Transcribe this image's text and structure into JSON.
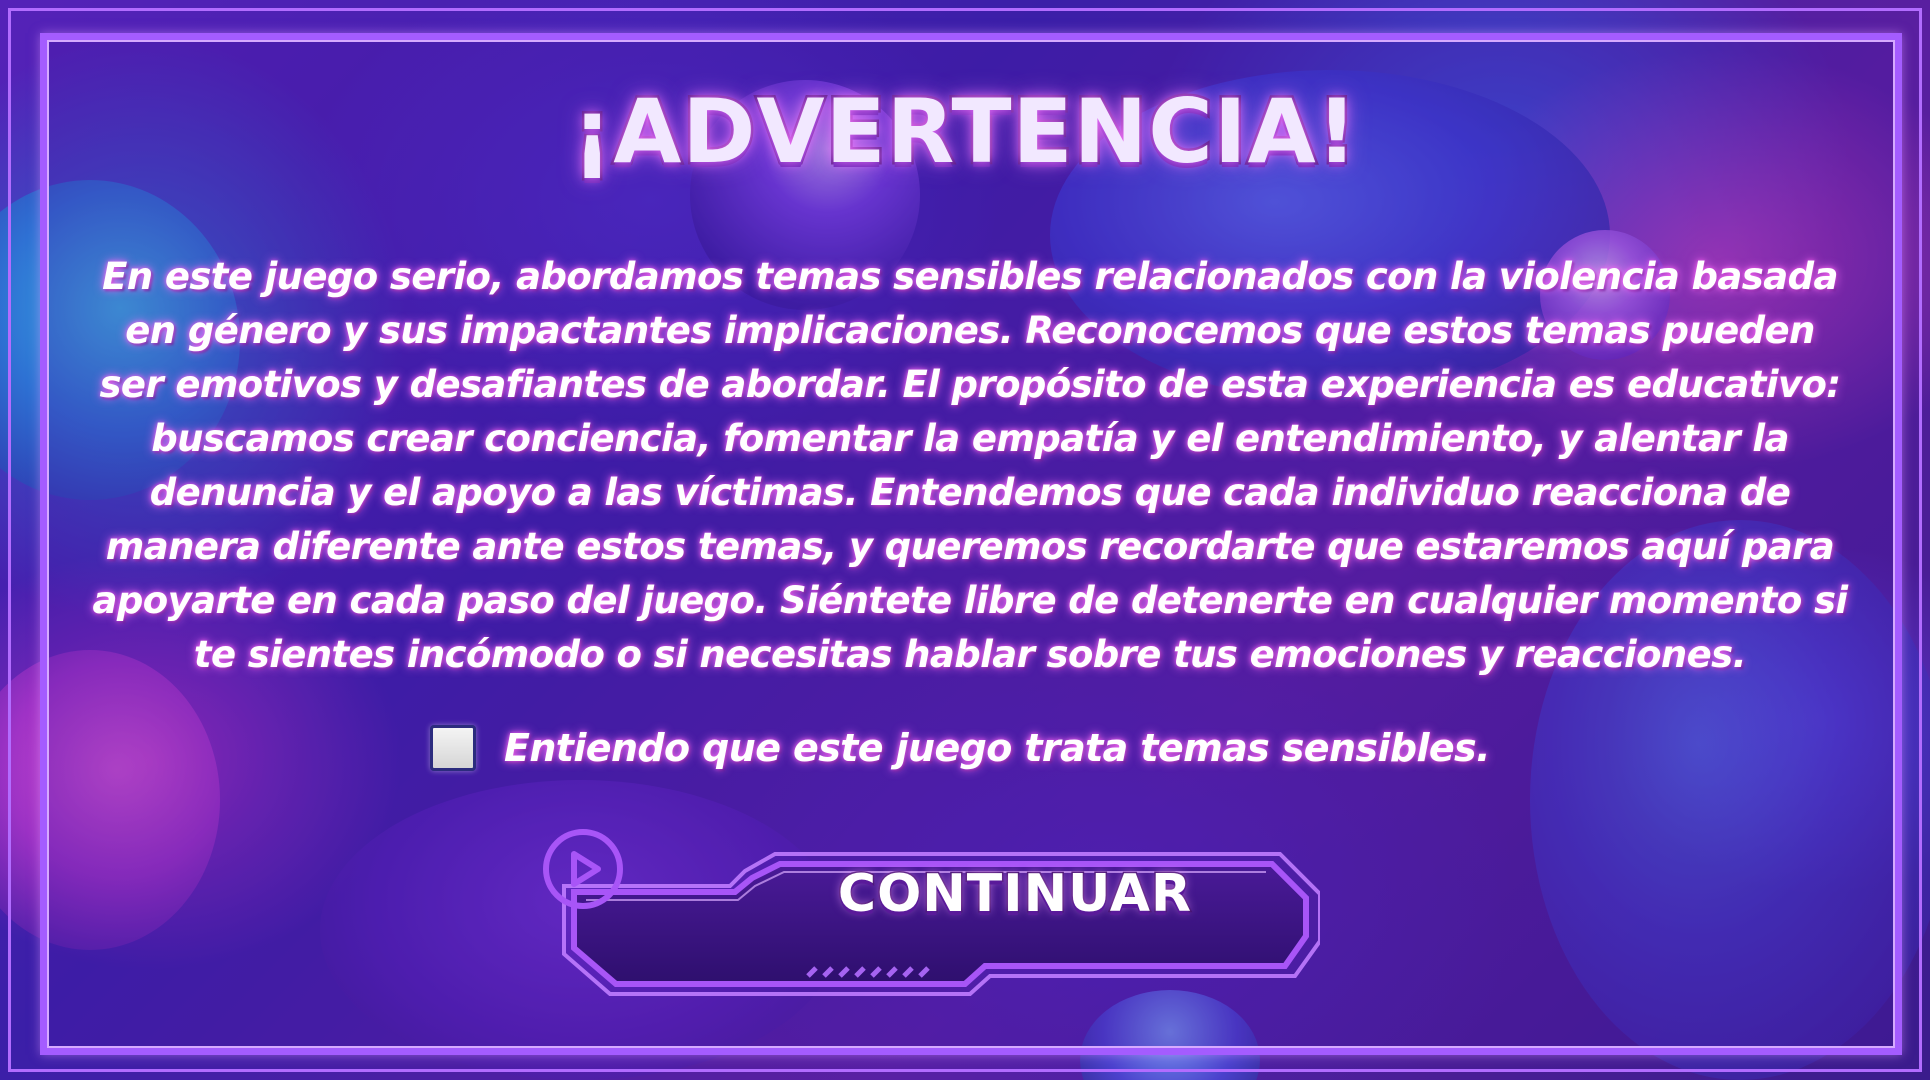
{
  "screen": {
    "title": "¡ADVERTENCIA!",
    "warning_paragraph": "En este juego serio, abordamos temas sensibles relacionados con la violencia basada en género y sus impactantes implicaciones. Reconocemos que estos temas pueden ser emotivos y desafiantes de abordar. El propósito de esta experiencia es educativo: buscamos crear conciencia, fomentar la empatía y el entendimiento, y alentar la denuncia y el apoyo a las víctimas. Entendemos que cada individuo reacciona de manera diferente ante estos temas, y queremos recordarte que estaremos aquí para apoyarte en cada paso del juego. Siéntete libre de detenerte en cualquier momento si te sientes incómodo o si necesitas hablar sobre tus emociones y reacciones."
  },
  "consent": {
    "label": "Entiendo que este juego trata temas sensibles.",
    "checked": false
  },
  "continue_button": {
    "label": "CONTINUAR",
    "icon": "play-circle-icon"
  },
  "colors": {
    "frame": "#a45cff",
    "button_fill": "#3a1380",
    "button_border": "#a855f7",
    "text_glow": "#ff78ff",
    "checkbox_border": "#2c2c7e"
  }
}
